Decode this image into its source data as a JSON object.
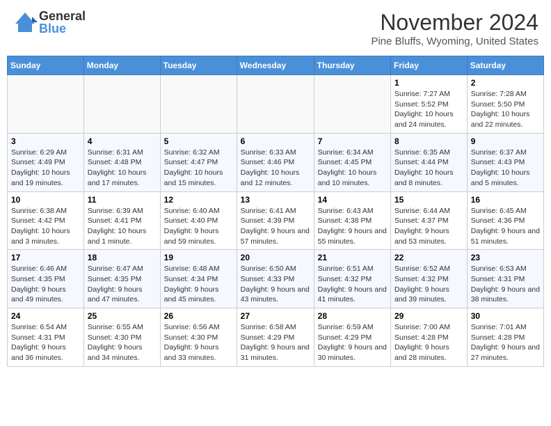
{
  "header": {
    "logo_general": "General",
    "logo_blue": "Blue",
    "month": "November 2024",
    "location": "Pine Bluffs, Wyoming, United States"
  },
  "days_of_week": [
    "Sunday",
    "Monday",
    "Tuesday",
    "Wednesday",
    "Thursday",
    "Friday",
    "Saturday"
  ],
  "weeks": [
    [
      {
        "day": "",
        "info": ""
      },
      {
        "day": "",
        "info": ""
      },
      {
        "day": "",
        "info": ""
      },
      {
        "day": "",
        "info": ""
      },
      {
        "day": "",
        "info": ""
      },
      {
        "day": "1",
        "info": "Sunrise: 7:27 AM\nSunset: 5:52 PM\nDaylight: 10 hours and 24 minutes."
      },
      {
        "day": "2",
        "info": "Sunrise: 7:28 AM\nSunset: 5:50 PM\nDaylight: 10 hours and 22 minutes."
      }
    ],
    [
      {
        "day": "3",
        "info": "Sunrise: 6:29 AM\nSunset: 4:49 PM\nDaylight: 10 hours and 19 minutes."
      },
      {
        "day": "4",
        "info": "Sunrise: 6:31 AM\nSunset: 4:48 PM\nDaylight: 10 hours and 17 minutes."
      },
      {
        "day": "5",
        "info": "Sunrise: 6:32 AM\nSunset: 4:47 PM\nDaylight: 10 hours and 15 minutes."
      },
      {
        "day": "6",
        "info": "Sunrise: 6:33 AM\nSunset: 4:46 PM\nDaylight: 10 hours and 12 minutes."
      },
      {
        "day": "7",
        "info": "Sunrise: 6:34 AM\nSunset: 4:45 PM\nDaylight: 10 hours and 10 minutes."
      },
      {
        "day": "8",
        "info": "Sunrise: 6:35 AM\nSunset: 4:44 PM\nDaylight: 10 hours and 8 minutes."
      },
      {
        "day": "9",
        "info": "Sunrise: 6:37 AM\nSunset: 4:43 PM\nDaylight: 10 hours and 5 minutes."
      }
    ],
    [
      {
        "day": "10",
        "info": "Sunrise: 6:38 AM\nSunset: 4:42 PM\nDaylight: 10 hours and 3 minutes."
      },
      {
        "day": "11",
        "info": "Sunrise: 6:39 AM\nSunset: 4:41 PM\nDaylight: 10 hours and 1 minute."
      },
      {
        "day": "12",
        "info": "Sunrise: 6:40 AM\nSunset: 4:40 PM\nDaylight: 9 hours and 59 minutes."
      },
      {
        "day": "13",
        "info": "Sunrise: 6:41 AM\nSunset: 4:39 PM\nDaylight: 9 hours and 57 minutes."
      },
      {
        "day": "14",
        "info": "Sunrise: 6:43 AM\nSunset: 4:38 PM\nDaylight: 9 hours and 55 minutes."
      },
      {
        "day": "15",
        "info": "Sunrise: 6:44 AM\nSunset: 4:37 PM\nDaylight: 9 hours and 53 minutes."
      },
      {
        "day": "16",
        "info": "Sunrise: 6:45 AM\nSunset: 4:36 PM\nDaylight: 9 hours and 51 minutes."
      }
    ],
    [
      {
        "day": "17",
        "info": "Sunrise: 6:46 AM\nSunset: 4:35 PM\nDaylight: 9 hours and 49 minutes."
      },
      {
        "day": "18",
        "info": "Sunrise: 6:47 AM\nSunset: 4:35 PM\nDaylight: 9 hours and 47 minutes."
      },
      {
        "day": "19",
        "info": "Sunrise: 6:48 AM\nSunset: 4:34 PM\nDaylight: 9 hours and 45 minutes."
      },
      {
        "day": "20",
        "info": "Sunrise: 6:50 AM\nSunset: 4:33 PM\nDaylight: 9 hours and 43 minutes."
      },
      {
        "day": "21",
        "info": "Sunrise: 6:51 AM\nSunset: 4:32 PM\nDaylight: 9 hours and 41 minutes."
      },
      {
        "day": "22",
        "info": "Sunrise: 6:52 AM\nSunset: 4:32 PM\nDaylight: 9 hours and 39 minutes."
      },
      {
        "day": "23",
        "info": "Sunrise: 6:53 AM\nSunset: 4:31 PM\nDaylight: 9 hours and 38 minutes."
      }
    ],
    [
      {
        "day": "24",
        "info": "Sunrise: 6:54 AM\nSunset: 4:31 PM\nDaylight: 9 hours and 36 minutes."
      },
      {
        "day": "25",
        "info": "Sunrise: 6:55 AM\nSunset: 4:30 PM\nDaylight: 9 hours and 34 minutes."
      },
      {
        "day": "26",
        "info": "Sunrise: 6:56 AM\nSunset: 4:30 PM\nDaylight: 9 hours and 33 minutes."
      },
      {
        "day": "27",
        "info": "Sunrise: 6:58 AM\nSunset: 4:29 PM\nDaylight: 9 hours and 31 minutes."
      },
      {
        "day": "28",
        "info": "Sunrise: 6:59 AM\nSunset: 4:29 PM\nDaylight: 9 hours and 30 minutes."
      },
      {
        "day": "29",
        "info": "Sunrise: 7:00 AM\nSunset: 4:28 PM\nDaylight: 9 hours and 28 minutes."
      },
      {
        "day": "30",
        "info": "Sunrise: 7:01 AM\nSunset: 4:28 PM\nDaylight: 9 hours and 27 minutes."
      }
    ]
  ]
}
